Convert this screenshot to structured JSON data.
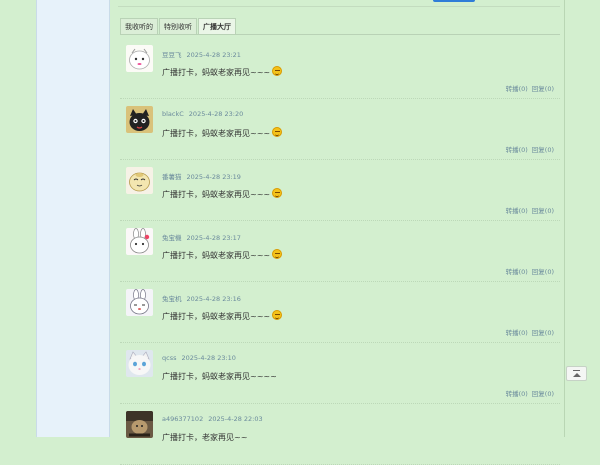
{
  "tabs": [
    {
      "label": "我收听的"
    },
    {
      "label": "特别收听"
    },
    {
      "label": "广播大厅"
    }
  ],
  "feed": [
    {
      "name": "豆豆飞",
      "time": "2025-4-28 23:21",
      "content": "广播打卡，蚂蚁老家再见~~~",
      "emoji": true,
      "repost": "转播(0)",
      "reply": "回复(0)"
    },
    {
      "name": "blackC",
      "time": "2025-4-28 23:20",
      "content": "广播打卡，蚂蚁老家再见~~~",
      "emoji": true,
      "repost": "转播(0)",
      "reply": "回复(0)"
    },
    {
      "name": "番薯猫",
      "time": "2025-4-28 23:19",
      "content": "广播打卡，蚂蚁老家再见~~~",
      "emoji": true,
      "repost": "转播(0)",
      "reply": "回复(0)"
    },
    {
      "name": "兔宝機",
      "time": "2025-4-28 23:17",
      "content": "广播打卡，蚂蚁老家再见~~~",
      "emoji": true,
      "repost": "转播(0)",
      "reply": "回复(0)"
    },
    {
      "name": "兔宝机",
      "time": "2025-4-28 23:16",
      "content": "广播打卡，蚂蚁老家再见~~~",
      "emoji": true,
      "repost": "转播(0)",
      "reply": "回复(0)"
    },
    {
      "name": "qcss",
      "time": "2025-4-28 23:10",
      "content": "广播打卡，蚂蚁老家再见~~~~",
      "emoji": false,
      "repost": "转播(0)",
      "reply": "回复(0)"
    },
    {
      "name": "a496377102",
      "time": "2025-4-28 22:03",
      "content": "广播打卡，老家再见~~",
      "emoji": false,
      "repost": "",
      "reply": ""
    }
  ]
}
